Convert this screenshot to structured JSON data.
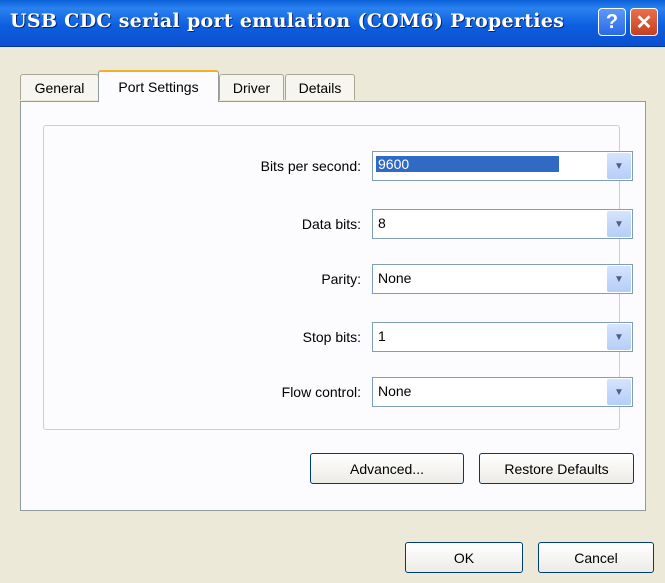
{
  "window": {
    "title": "USB CDC serial port emulation (COM6) Properties",
    "help_glyph": "?",
    "close_glyph": "✕"
  },
  "tabs": [
    {
      "label": "General",
      "active": false
    },
    {
      "label": "Port Settings",
      "active": true
    },
    {
      "label": "Driver",
      "active": false
    },
    {
      "label": "Details",
      "active": false
    }
  ],
  "port_settings": {
    "fields": [
      {
        "label": "Bits per second:",
        "value": "9600",
        "highlighted": true
      },
      {
        "label": "Data bits:",
        "value": "8",
        "highlighted": false
      },
      {
        "label": "Parity:",
        "value": "None",
        "highlighted": false
      },
      {
        "label": "Stop bits:",
        "value": "1",
        "highlighted": false
      },
      {
        "label": "Flow control:",
        "value": "None",
        "highlighted": false
      }
    ],
    "advanced_label": "Advanced...",
    "restore_label": "Restore Defaults"
  },
  "footer": {
    "ok_label": "OK",
    "cancel_label": "Cancel"
  },
  "icons": {
    "dropdown": "chevron-down-icon",
    "help": "help-icon",
    "close": "close-icon"
  },
  "colors": {
    "titlebar": "#0a5fd8",
    "selection": "#316ac5",
    "active_tab_accent": "#f0b02a",
    "close_button": "#c6401f"
  }
}
